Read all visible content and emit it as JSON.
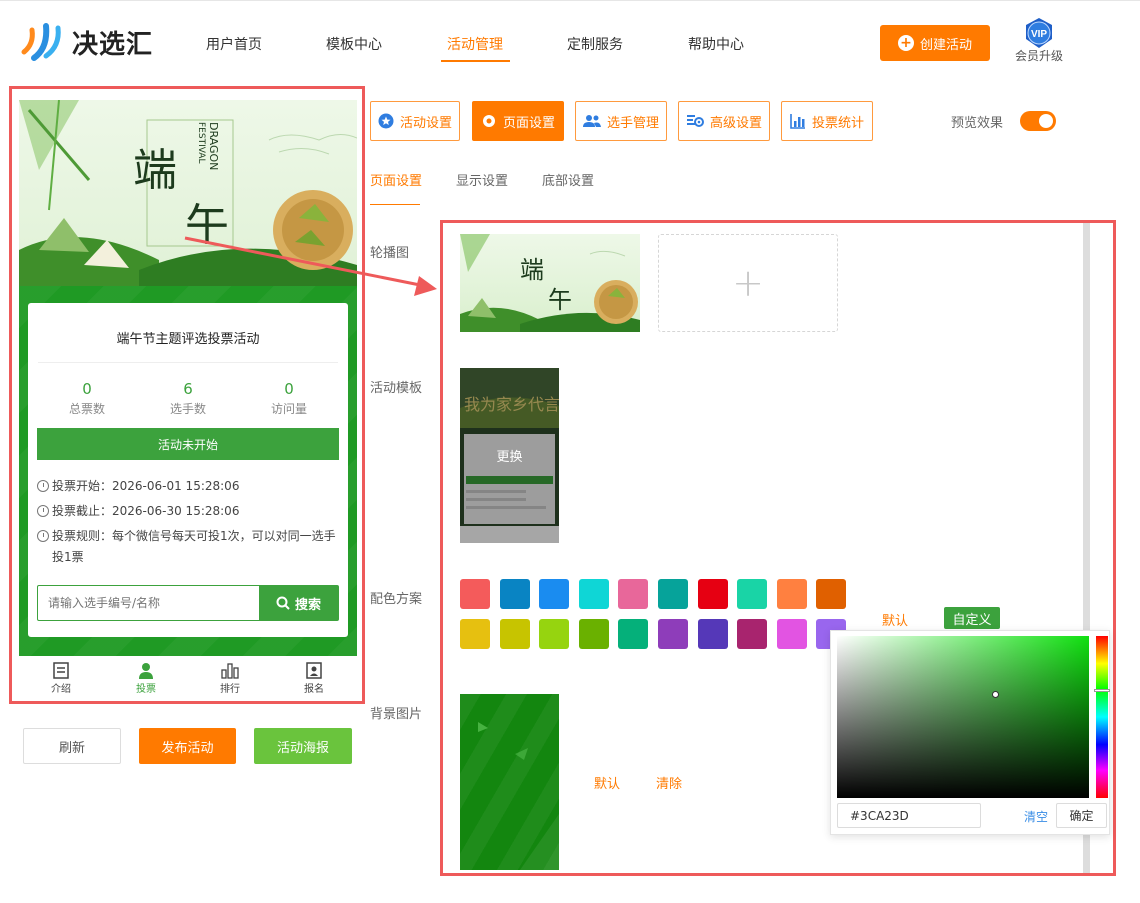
{
  "header": {
    "logo_text": "决选汇",
    "nav": [
      "用户首页",
      "模板中心",
      "活动管理",
      "定制服务",
      "帮助中心"
    ],
    "active_nav": "活动管理",
    "create_label": "创建活动",
    "vip_badge": "VIP",
    "vip_label": "会员升级"
  },
  "preview": {
    "banner_title": "端午",
    "banner_en_1": "FESTIVAL",
    "banner_en_2": "DRAGON",
    "card_title": "端午节主题评选投票活动",
    "stats": [
      {
        "value": "0",
        "label": "总票数"
      },
      {
        "value": "6",
        "label": "选手数"
      },
      {
        "value": "0",
        "label": "访问量"
      }
    ],
    "status": "活动未开始",
    "start": "投票开始：2026-06-01 15:28:06",
    "end": "投票截止：2026-06-30 15:28:06",
    "rule_line1": "投票规则：每个微信号每天可投1次，可以对同一选手",
    "rule_line2": "投1票",
    "search_placeholder": "请输入选手编号/名称",
    "search_label": "搜索",
    "tabs": [
      "介绍",
      "投票",
      "排行",
      "报名"
    ],
    "active_tab": "投票"
  },
  "actions": {
    "refresh": "刷新",
    "publish": "发布活动",
    "poster": "活动海报"
  },
  "settings_tabs": [
    "活动设置",
    "页面设置",
    "选手管理",
    "高级设置",
    "投票统计"
  ],
  "active_settings_tab": "页面设置",
  "preview_effect": {
    "label": "预览效果",
    "enabled": true
  },
  "sub_tabs": [
    "页面设置",
    "显示设置",
    "底部设置"
  ],
  "active_sub_tab": "页面设置",
  "sections": {
    "carousel": "轮播图",
    "template": "活动模板",
    "color": "配色方案",
    "background": "背景图片"
  },
  "template_change": "更换",
  "template_thumb_title": "我为家乡代言",
  "add_symbol": "+",
  "color_scheme": {
    "swatches": [
      "#f45b5b",
      "#0984c3",
      "#1a8cf0",
      "#0fd6d6",
      "#e8679a",
      "#06a39a",
      "#e60012",
      "#19d4a6",
      "#ff8040",
      "#e06000",
      "#e6c010",
      "#c7c400",
      "#96d40f",
      "#6ab100",
      "#05b07a",
      "#8e3dba",
      "#5538b8",
      "#a8246e",
      "#e254e2",
      "#9966ee"
    ],
    "default_label": "默认",
    "custom_label": "自定义"
  },
  "background": {
    "default_label": "默认",
    "clear_label": "清除"
  },
  "color_picker": {
    "hex": "#3CA23D",
    "clear_label": "清空",
    "confirm_label": "确定"
  },
  "colors": {
    "accent": "#ff7a00",
    "green": "#3ca23d",
    "highlight_border": "#ee5a5a"
  }
}
